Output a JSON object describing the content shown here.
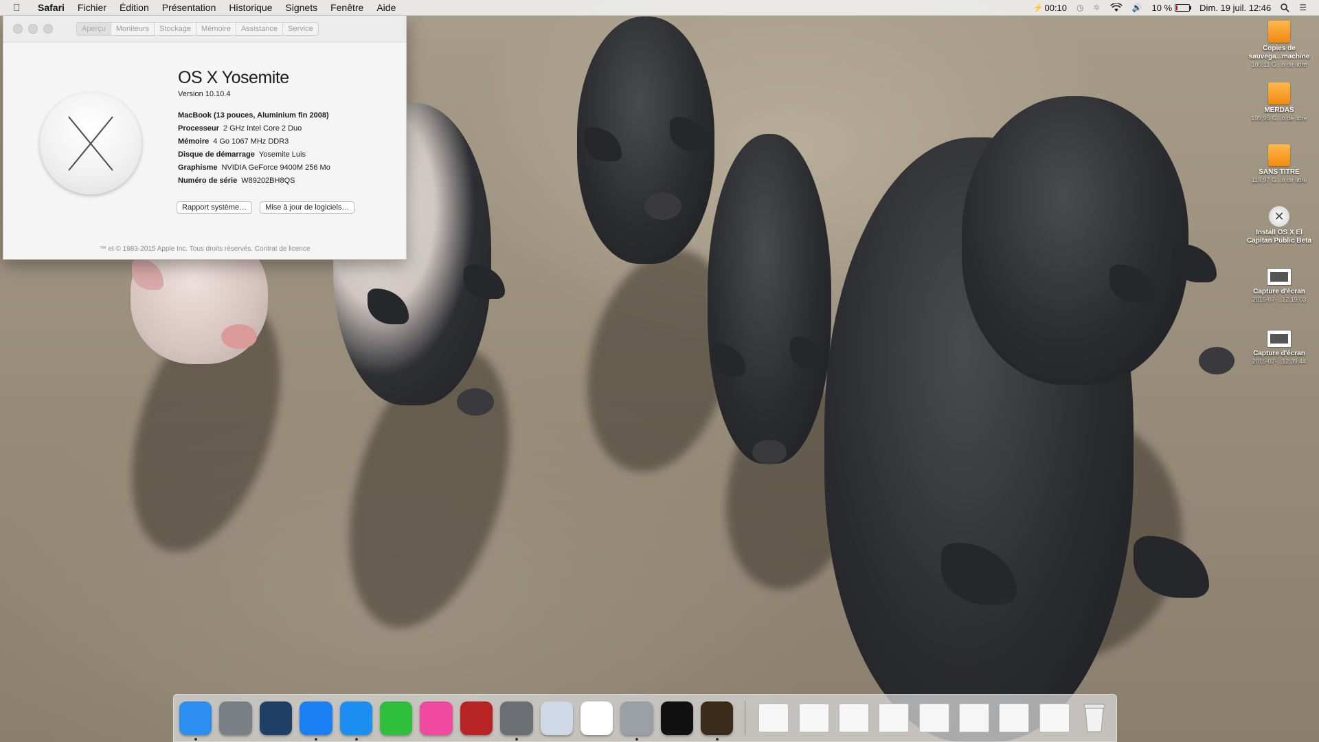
{
  "menubar": {
    "app_name": "Safari",
    "menus": [
      "Fichier",
      "Édition",
      "Présentation",
      "Historique",
      "Signets",
      "Fenêtre",
      "Aide"
    ],
    "battery_time": "00:10",
    "battery_percent": "10 %",
    "datetime": "Dim. 19 juil.  12:46",
    "battery_level": 0.1
  },
  "about": {
    "tabs": [
      "Aperçu",
      "Moniteurs",
      "Stockage",
      "Mémoire",
      "Assistance",
      "Service"
    ],
    "os_name_bold": "OS X",
    "os_name": "Yosemite",
    "version": "Version 10.10.4",
    "model": "MacBook (13 pouces, Aluminium fin 2008)",
    "specs": [
      {
        "key": "Processeur",
        "value": "2 GHz Intel Core 2 Duo"
      },
      {
        "key": "Mémoire",
        "value": "4 Go 1067 MHz DDR3"
      },
      {
        "key": "Disque de démarrage",
        "value": "Yosemite Luis"
      },
      {
        "key": "Graphisme",
        "value": "NVIDIA GeForce 9400M 256 Mo"
      },
      {
        "key": "Numéro de série",
        "value": "W89202BH8QS"
      }
    ],
    "btn_report": "Rapport système…",
    "btn_update": "Mise à jour de logiciels…",
    "copyright": "™ et © 1983-2015 Apple Inc. Tous droits réservés. Contrat de licence"
  },
  "desktop_icons": [
    {
      "label": "Copies de sauvega...machine",
      "sub": "180,11 G...o de libre",
      "kind": "drive"
    },
    {
      "label": "MERDAS",
      "sub": "199,95 G...o de libre",
      "kind": "drive"
    },
    {
      "label": "SANS TITRE",
      "sub": "119,97 G...o de libre",
      "kind": "drive"
    },
    {
      "label": "Install OS X El Capitan Public Beta",
      "sub": "",
      "kind": "installer"
    },
    {
      "label": "Capture d'écran",
      "sub": "2015-07-...12.19.03",
      "kind": "screenshot"
    },
    {
      "label": "Capture d'écran",
      "sub": "2015-07-...12.39.44",
      "kind": "screenshot"
    }
  ],
  "dock": {
    "apps": [
      {
        "name": "finder-icon",
        "color": "#2b8ef0",
        "running": true
      },
      {
        "name": "launchpad-icon",
        "color": "#7a7f86",
        "running": false
      },
      {
        "name": "mission-control-icon",
        "color": "#1f3f66",
        "running": false
      },
      {
        "name": "app-store-icon",
        "color": "#1a7ff2",
        "running": true
      },
      {
        "name": "safari-icon",
        "color": "#1c8ef2",
        "running": true
      },
      {
        "name": "facetime-icon",
        "color": "#2fbf3c",
        "running": false
      },
      {
        "name": "itunes-icon",
        "color": "#f04aa0",
        "running": false
      },
      {
        "name": "photo-booth-icon",
        "color": "#b82424",
        "running": false
      },
      {
        "name": "system-preferences-icon",
        "color": "#6b6f74",
        "running": true
      },
      {
        "name": "preview-icon",
        "color": "#cfd8e6",
        "running": false
      },
      {
        "name": "photos-icon",
        "color": "#ffffff",
        "running": false
      },
      {
        "name": "disk-utility-icon",
        "color": "#9aa0a6",
        "running": true
      },
      {
        "name": "terminal-icon",
        "color": "#111111",
        "running": false
      },
      {
        "name": "garageband-icon",
        "color": "#3a2a1a",
        "running": true
      }
    ],
    "docs": [
      "document-icon",
      "printer-icon",
      "window-thumb-icon",
      "window-thumb-icon",
      "window-thumb-icon",
      "window-thumb-icon",
      "window-thumb-icon",
      "window-thumb-icon"
    ]
  }
}
